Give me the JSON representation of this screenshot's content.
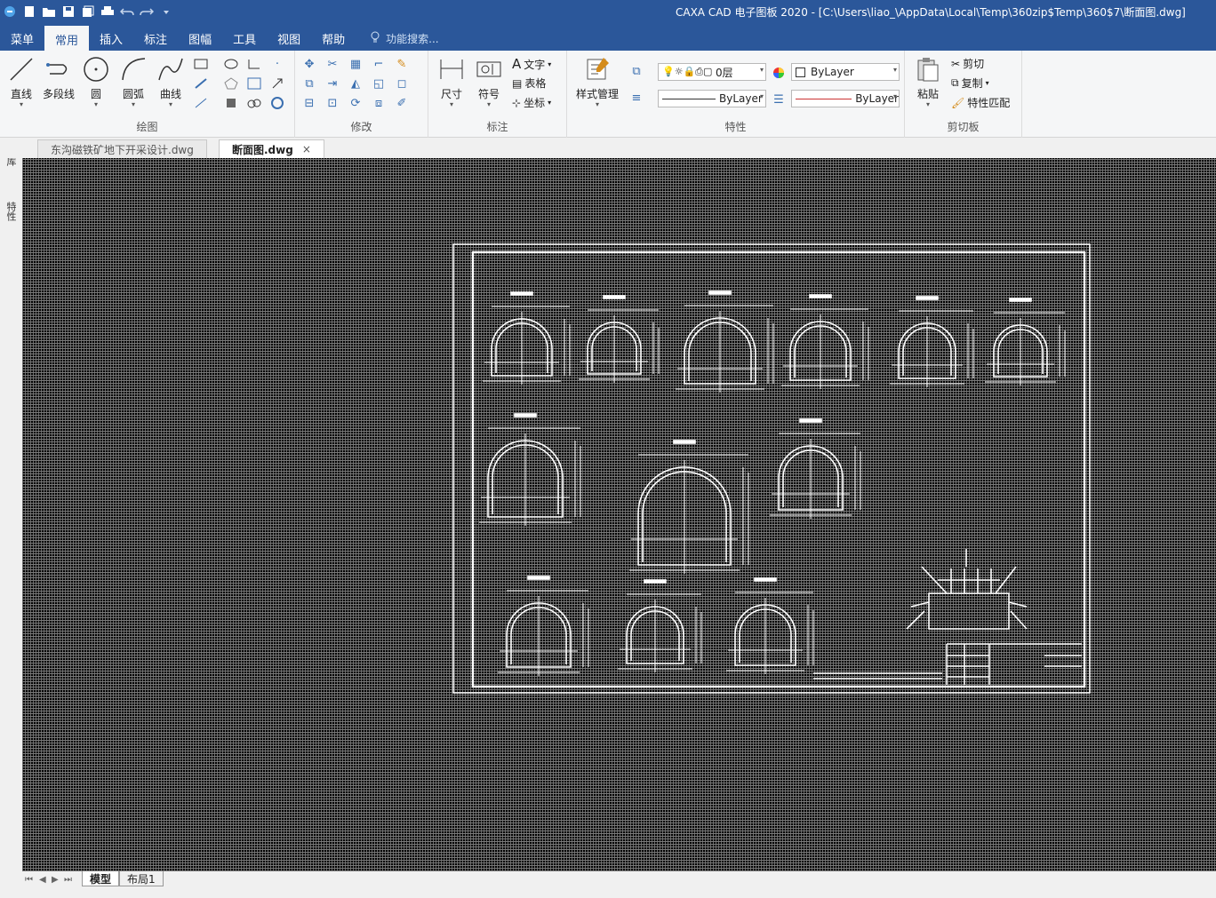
{
  "titlebar": {
    "title": "CAXA CAD 电子图板 2020 - [C:\\Users\\liao_\\AppData\\Local\\Temp\\360zip$Temp\\360$7\\断面图.dwg]",
    "qat_icons": [
      "app-icon",
      "new-icon",
      "open-icon",
      "save-icon",
      "save-all-icon",
      "print-icon",
      "undo-icon",
      "redo-icon",
      "customize-icon"
    ]
  },
  "menu": {
    "tabs": [
      "菜单",
      "常用",
      "插入",
      "标注",
      "图幅",
      "工具",
      "视图",
      "帮助"
    ],
    "active": "常用",
    "search_placeholder": "功能搜索..."
  },
  "ribbon": {
    "draw": {
      "label": "绘图",
      "line": "直线",
      "polyline": "多段线",
      "circle": "圆",
      "arc": "圆弧",
      "curve": "曲线"
    },
    "modify": {
      "label": "修改"
    },
    "annotate": {
      "label": "标注",
      "dimension": "尺寸",
      "symbol": "符号",
      "text": "文字",
      "table": "表格",
      "coordinate": "坐标"
    },
    "properties": {
      "label": "特性",
      "style_manager": "样式管理",
      "layer": "0层",
      "color": "ByLayer",
      "linetype": "ByLayer",
      "lineweight": "ByLayer"
    },
    "clipboard": {
      "label": "剪切板",
      "paste": "粘贴",
      "cut": "剪切",
      "copy": "复制",
      "match": "特性匹配"
    }
  },
  "doc_tabs": [
    {
      "label": "东沟磁铁矿地下开采设计.dwg",
      "active": false
    },
    {
      "label": "断面图.dwg",
      "active": true
    }
  ],
  "close_glyph": "×",
  "side_panels": [
    "图库",
    "特性"
  ],
  "layout_tabs": [
    {
      "label": "模型",
      "active": true
    },
    {
      "label": "布局1",
      "active": false
    }
  ],
  "colors": {
    "titlebar": "#2b579a",
    "canvas": "#000000",
    "drawing_lines": "#ffffff"
  }
}
